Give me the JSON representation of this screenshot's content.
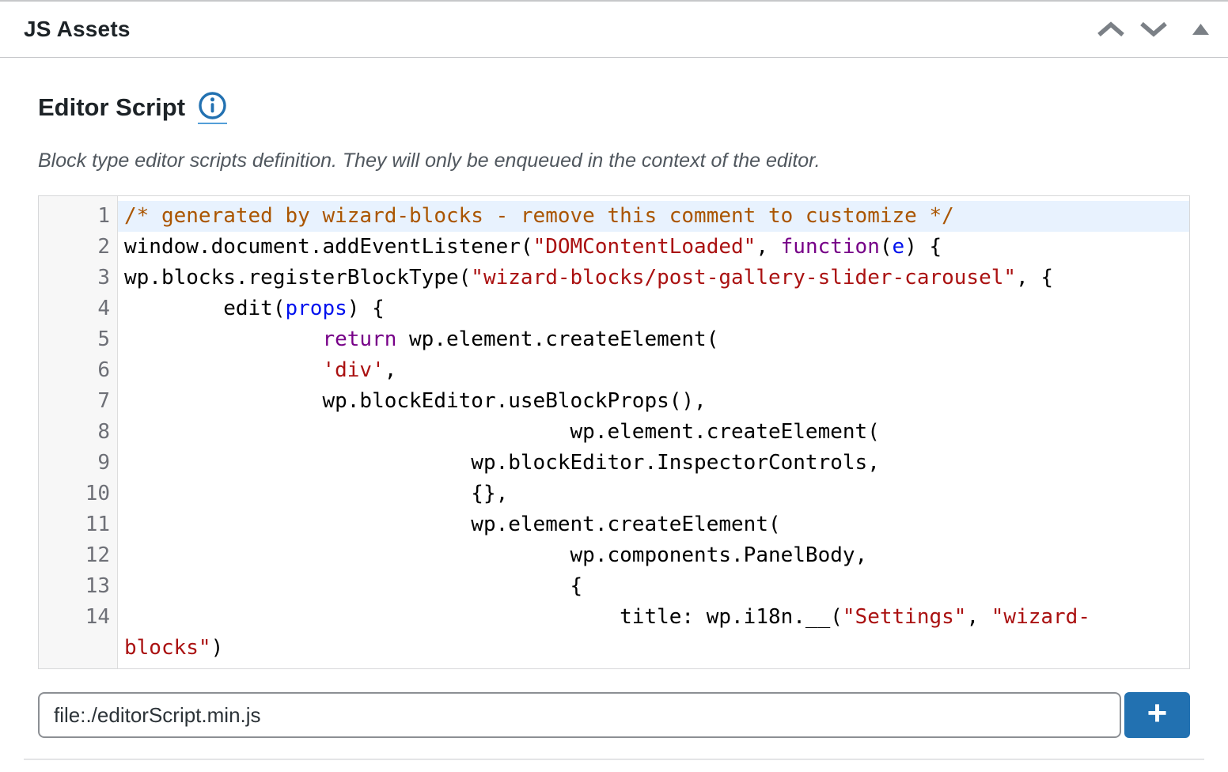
{
  "panel": {
    "title": "JS Assets",
    "controls": {
      "move_up_icon": "chevron-up",
      "move_down_icon": "chevron-down",
      "toggle_icon": "triangle-up"
    }
  },
  "section": {
    "title": "Editor Script",
    "info_icon": "info-circle",
    "description": "Block type editor scripts definition. They will only be enqueued in the context of the editor."
  },
  "code_editor": {
    "language": "javascript",
    "active_line": 1,
    "lines": [
      {
        "num": "1",
        "active": true,
        "tokens": [
          [
            "/* generated by wizard-blocks - remove this comment to customize */",
            "comment"
          ]
        ]
      },
      {
        "num": "2",
        "tokens": [
          [
            "window.document.addEventListener(",
            "plain"
          ],
          [
            "\"DOMContentLoaded\"",
            "string"
          ],
          [
            ", ",
            "plain"
          ],
          [
            "function",
            "keyword"
          ],
          [
            "(",
            "plain"
          ],
          [
            "e",
            "def"
          ],
          [
            ") {",
            "plain"
          ]
        ]
      },
      {
        "num": "3",
        "tokens": [
          [
            "wp.blocks.registerBlockType(",
            "plain"
          ],
          [
            "\"wizard-blocks/post-gallery-slider-carousel\"",
            "string"
          ],
          [
            ", {",
            "plain"
          ]
        ]
      },
      {
        "num": "4",
        "tokens": [
          [
            "        edit(",
            "plain"
          ],
          [
            "props",
            "def"
          ],
          [
            ") {",
            "plain"
          ]
        ]
      },
      {
        "num": "5",
        "tokens": [
          [
            "                ",
            "plain"
          ],
          [
            "return",
            "keyword"
          ],
          [
            " wp.element.createElement(",
            "plain"
          ]
        ]
      },
      {
        "num": "6",
        "tokens": [
          [
            "                ",
            "plain"
          ],
          [
            "'div'",
            "string"
          ],
          [
            ",",
            "plain"
          ]
        ]
      },
      {
        "num": "7",
        "tokens": [
          [
            "                wp.blockEditor.useBlockProps(),",
            "plain"
          ]
        ]
      },
      {
        "num": "8",
        "tokens": [
          [
            "                                    wp.element.createElement(",
            "plain"
          ]
        ]
      },
      {
        "num": "9",
        "tokens": [
          [
            "                            wp.blockEditor.InspectorControls,",
            "plain"
          ]
        ]
      },
      {
        "num": "10",
        "tokens": [
          [
            "                            {},",
            "plain"
          ]
        ]
      },
      {
        "num": "11",
        "tokens": [
          [
            "                            wp.element.createElement(",
            "plain"
          ]
        ]
      },
      {
        "num": "12",
        "tokens": [
          [
            "                                    wp.components.PanelBody,",
            "plain"
          ]
        ]
      },
      {
        "num": "13",
        "tokens": [
          [
            "                                    {",
            "plain"
          ]
        ]
      },
      {
        "num": "14",
        "tokens": [
          [
            "                                        title: wp.i18n.__(",
            "plain"
          ],
          [
            "\"Settings\"",
            "string"
          ],
          [
            ", ",
            "plain"
          ],
          [
            "\"wizard-",
            "string"
          ]
        ]
      },
      {
        "num": "",
        "wrap": true,
        "tokens": [
          [
            "blocks\"",
            "string"
          ],
          [
            ")",
            "plain"
          ]
        ]
      }
    ]
  },
  "asset_input": {
    "value": "file:./editorScript.min.js",
    "add_button_label": "+"
  },
  "colors": {
    "accent_blue": "#2271b1",
    "syntax_comment": "#aa5500",
    "syntax_string": "#aa1111",
    "syntax_keyword": "#770088",
    "syntax_variable": "#0011ee",
    "active_line_background": "#e8f2fe"
  }
}
